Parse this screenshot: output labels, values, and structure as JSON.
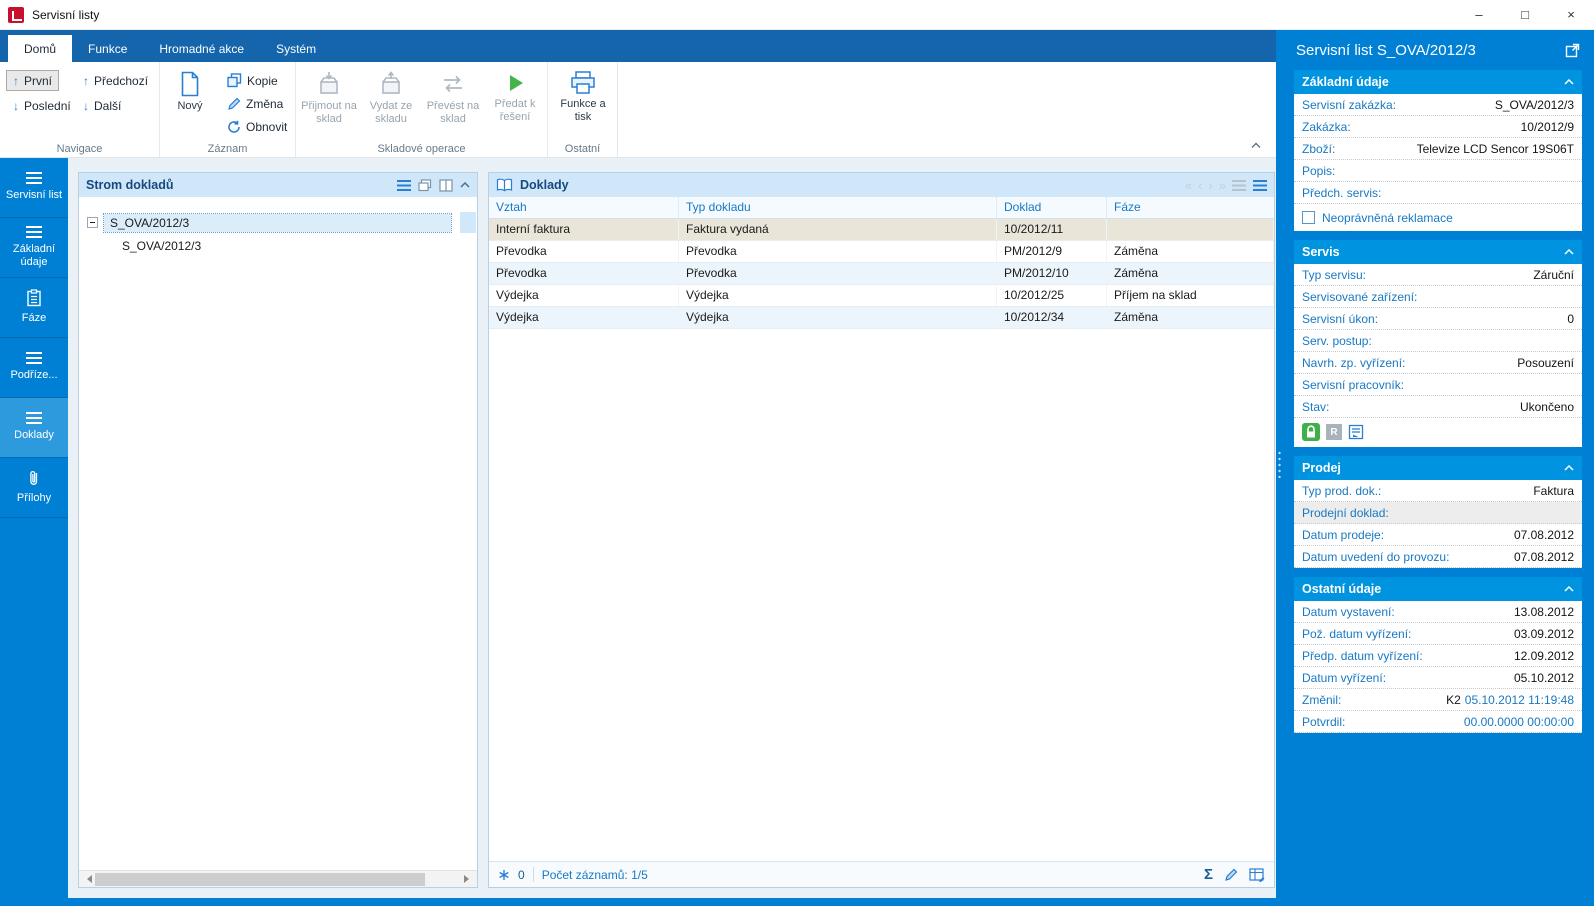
{
  "window": {
    "title": "Servisní listy",
    "minimize": "–",
    "maximize": "□",
    "close": "×"
  },
  "icons": {
    "arrow_up": "↑",
    "arrow_down": "↓",
    "nav_first": "«",
    "nav_prev": "‹",
    "nav_next": "›",
    "nav_last": "»",
    "sum": "Σ",
    "r_badge": "R"
  },
  "ribbon": {
    "tabs": [
      "Domů",
      "Funkce",
      "Hromadné akce",
      "Systém"
    ],
    "groups": {
      "navigace": {
        "label": "Navigace",
        "first": "První",
        "last": "Poslední",
        "prev": "Předchozí",
        "next": "Další"
      },
      "zaznam": {
        "label": "Záznam",
        "new": "Nový",
        "copy": "Kopie",
        "change": "Změna",
        "refresh": "Obnovit"
      },
      "sklad": {
        "label": "Skladové operace",
        "receive": "Přijmout na sklad",
        "issue": "Vydat ze skladu",
        "transfer": "Převést na sklad",
        "handover": "Předat k řešení"
      },
      "ostatni": {
        "label": "Ostatní",
        "print": "Funkce a tisk"
      }
    }
  },
  "sidebar": {
    "items": [
      {
        "label": "Servisní list"
      },
      {
        "label": "Základní údaje"
      },
      {
        "label": "Fáze"
      },
      {
        "label": "Podříze..."
      },
      {
        "label": "Doklady"
      },
      {
        "label": "Přílohy"
      }
    ]
  },
  "tree": {
    "title": "Strom dokladů",
    "nodes": [
      {
        "label": "S_OVA/2012/3"
      },
      {
        "label": "S_OVA/2012/3"
      }
    ]
  },
  "documents": {
    "title": "Doklady",
    "columns": [
      "Vztah",
      "Typ dokladu",
      "Doklad",
      "Fáze"
    ],
    "rows": [
      {
        "cells": [
          "Interní faktura",
          "Faktura vydaná",
          "10/2012/11",
          ""
        ]
      },
      {
        "cells": [
          "Převodka",
          "Převodka",
          "PM/2012/9",
          "Záměna"
        ]
      },
      {
        "cells": [
          "Převodka",
          "Převodka",
          "PM/2012/10",
          "Záměna"
        ]
      },
      {
        "cells": [
          "Výdejka",
          "Výdejka",
          "10/2012/25",
          "Příjem na sklad"
        ]
      },
      {
        "cells": [
          "Výdejka",
          "Výdejka",
          "10/2012/34",
          "Záměna"
        ]
      }
    ],
    "status": {
      "badge": "0",
      "records": "Počet záznamů: 1/5"
    }
  },
  "detail": {
    "title": "Servisní list S_OVA/2012/3",
    "sections": {
      "zakladni": {
        "title": "Základní údaje",
        "fields": [
          {
            "label": "Servisní zakázka:",
            "value": "S_OVA/2012/3"
          },
          {
            "label": "Zakázka:",
            "value": "10/2012/9"
          },
          {
            "label": "Zboží:",
            "value": "Televize LCD Sencor 19S06T"
          },
          {
            "label": "Popis:",
            "value": ""
          },
          {
            "label": "Předch. servis:",
            "value": ""
          }
        ],
        "checkbox_label": "Neoprávněná reklamace"
      },
      "servis": {
        "title": "Servis",
        "fields": [
          {
            "label": "Typ servisu:",
            "value": "Záruční"
          },
          {
            "label": "Servisované zařízení:",
            "value": ""
          },
          {
            "label": "Servisní úkon:",
            "value": "0"
          },
          {
            "label": "Serv. postup:",
            "value": ""
          },
          {
            "label": "Navrh. zp. vyřízení:",
            "value": "Posouzení"
          },
          {
            "label": "Servisní pracovník:",
            "value": ""
          },
          {
            "label": "Stav:",
            "value": "Ukončeno"
          }
        ]
      },
      "prodej": {
        "title": "Prodej",
        "fields": [
          {
            "label": "Typ prod. dok.:",
            "value": "Faktura"
          },
          {
            "label": "Prodejní doklad:",
            "value": ""
          },
          {
            "label": "Datum prodeje:",
            "value": "07.08.2012"
          },
          {
            "label": "Datum uvedení do provozu:",
            "value": "07.08.2012"
          }
        ]
      },
      "ostatni": {
        "title": "Ostatní údaje",
        "fields": [
          {
            "label": "Datum vystavení:",
            "value": "13.08.2012"
          },
          {
            "label": "Pož. datum vyřízení:",
            "value": "03.09.2012"
          },
          {
            "label": "Předp. datum vyřízení:",
            "value": "12.09.2012"
          },
          {
            "label": "Datum vyřízení:",
            "value": "05.10.2012"
          },
          {
            "label": "Změnil:",
            "value": "K2",
            "time": "05.10.2012 11:19:48"
          },
          {
            "label": "Potvrdil:",
            "value": "",
            "time": "00.00.0000 00:00:00"
          }
        ]
      }
    }
  },
  "colors": {
    "primary_blue": "#0080d4",
    "section_header_blue": "#0093e0",
    "label_blue": "#1779c4",
    "selected_row": "#e9e5d8"
  }
}
